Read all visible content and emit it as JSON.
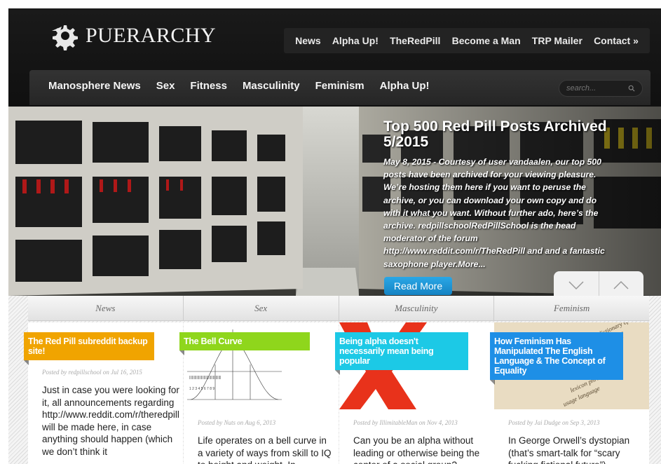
{
  "brand": {
    "name": "PUERARCHY"
  },
  "top_nav": [
    "News",
    "Alpha Up!",
    "TheRedPill",
    "Become a Man",
    "TRP Mailer",
    "Contact »"
  ],
  "category_nav": [
    "Manosphere News",
    "Sex",
    "Fitness",
    "Masculinity",
    "Feminism",
    "Alpha Up!"
  ],
  "search": {
    "placeholder": "search..."
  },
  "hero": {
    "title": "Top 500 Red Pill Posts Archived 5/2015",
    "body": "May 8, 2015 - Courtesy of user vandaalen, our top 500 posts have been archived for your viewing pleasure. We’re hosting them here if you want to peruse the archive, or you can download your own copy and do with it what you want.  Without further ado, here’s the archive. redpillschoolRedPillSchool is the head moderator of the forum http://www.reddit.com/r/TheRedPill and and a fantastic saxophone player.More...",
    "button": "Read More"
  },
  "tabs": [
    "News",
    "Sex",
    "Masculinity",
    "Feminism"
  ],
  "columns": [
    {
      "ribbon": "The Red Pill subreddit backup site!",
      "ribbon_color": "#f0a400",
      "meta": "Posted by redpillschool on Jul 16, 2015",
      "excerpt": "Just in case you were looking for it, all announcements regarding http://www.reddit.com/r/theredpill will be made here, in case anything should happen (which we don’t think it"
    },
    {
      "ribbon": "The Bell Curve",
      "ribbon_color": "#8fd61c",
      "meta": "Posted by Nuts on Aug 6, 2013",
      "excerpt": "Life operates on a bell curve in a variety of ways from skill to IQ to height and weight. In"
    },
    {
      "ribbon": "Being alpha doesn't necessarily mean being popular",
      "ribbon_color": "#1cc9e6",
      "meta": "Posted by IllimitableMan on Nov 4, 2013",
      "excerpt": "Can you be an alpha without leading  or otherwise being the center of a social group?"
    },
    {
      "ribbon": "How Feminism Has Manipulated The English Language & The Concept of Equality",
      "ribbon_color": "#1e8fe6",
      "meta": "Posted by Jai Dudge on Sep 3, 2013",
      "excerpt": "In George Orwell’s dystopian (that’s smart-talk for “scary fucking fictional future”)"
    }
  ],
  "colors": {
    "accent_blue": "#1f95d6",
    "bar_dark": "#1a1a1a"
  }
}
